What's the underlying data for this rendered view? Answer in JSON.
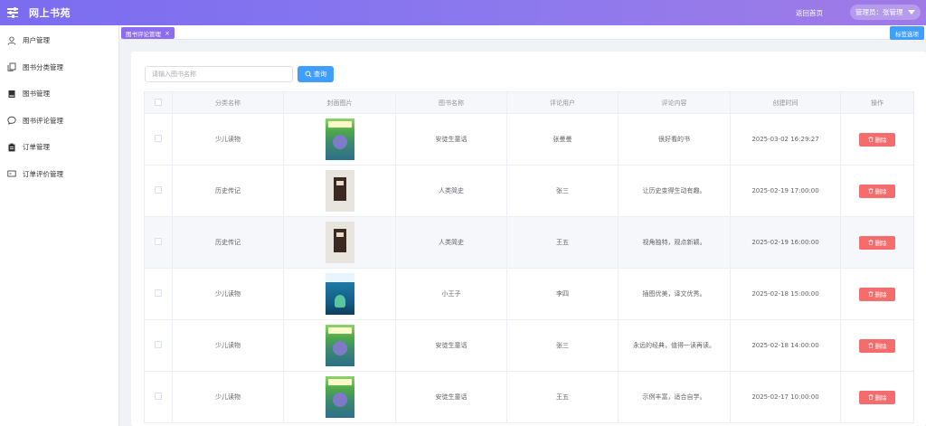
{
  "app": {
    "title": "网上书苑"
  },
  "header": {
    "return_home": "返回首页",
    "user_label": "管理员：张管理"
  },
  "sidebar": {
    "items": [
      {
        "label": "用户管理",
        "icon": "user-icon"
      },
      {
        "label": "图书分类管理",
        "icon": "copy-icon"
      },
      {
        "label": "图书管理",
        "icon": "book-icon"
      },
      {
        "label": "图书评论管理",
        "icon": "chat-icon"
      },
      {
        "label": "订单管理",
        "icon": "clipboard-icon"
      },
      {
        "label": "订单评价管理",
        "icon": "tickets-icon"
      }
    ]
  },
  "tabs": {
    "active": "图书评论管理",
    "close": "×",
    "options_label": "标签选项"
  },
  "search": {
    "placeholder": "请输入图书名称",
    "button_label": "查询"
  },
  "table": {
    "headers": [
      "分类名称",
      "封面图片",
      "图书名称",
      "评论用户",
      "评论内容",
      "创建时间",
      "操作"
    ],
    "rows": [
      {
        "category": "少儿读物",
        "cover": "green",
        "book": "安徒生童话",
        "user": "张曼曼",
        "content": "很好看的书",
        "time": "2025-03-02 16:29:27",
        "action": "删除"
      },
      {
        "category": "历史传记",
        "cover": "beige",
        "book": "人类简史",
        "user": "张三",
        "content": "让历史变得生动有趣。",
        "time": "2025-02-19 17:00:00",
        "action": "删除"
      },
      {
        "category": "历史传记",
        "cover": "beige",
        "book": "人类简史",
        "user": "王五",
        "content": "视角独特，观点新颖。",
        "time": "2025-02-19 16:00:00",
        "action": "删除"
      },
      {
        "category": "少儿读物",
        "cover": "teal",
        "book": "小王子",
        "user": "李四",
        "content": "插图优美，译文优秀。",
        "time": "2025-02-18 15:00:00",
        "action": "删除"
      },
      {
        "category": "少儿读物",
        "cover": "green",
        "book": "安徒生童话",
        "user": "张三",
        "content": "永远的经典，值得一读再读。",
        "time": "2025-02-18 14:00:00",
        "action": "删除"
      },
      {
        "category": "少儿读物",
        "cover": "green",
        "book": "安徒生童话",
        "user": "王五",
        "content": "示例丰富，适合自学。",
        "time": "2025-02-17 10:00:00",
        "action": "删除"
      }
    ]
  },
  "colors": {
    "header_start": "#7b6cf0",
    "header_end": "#a07ae6",
    "primary": "#409eff",
    "danger": "#f56c6c",
    "tab_active": "#8c6cf0"
  }
}
